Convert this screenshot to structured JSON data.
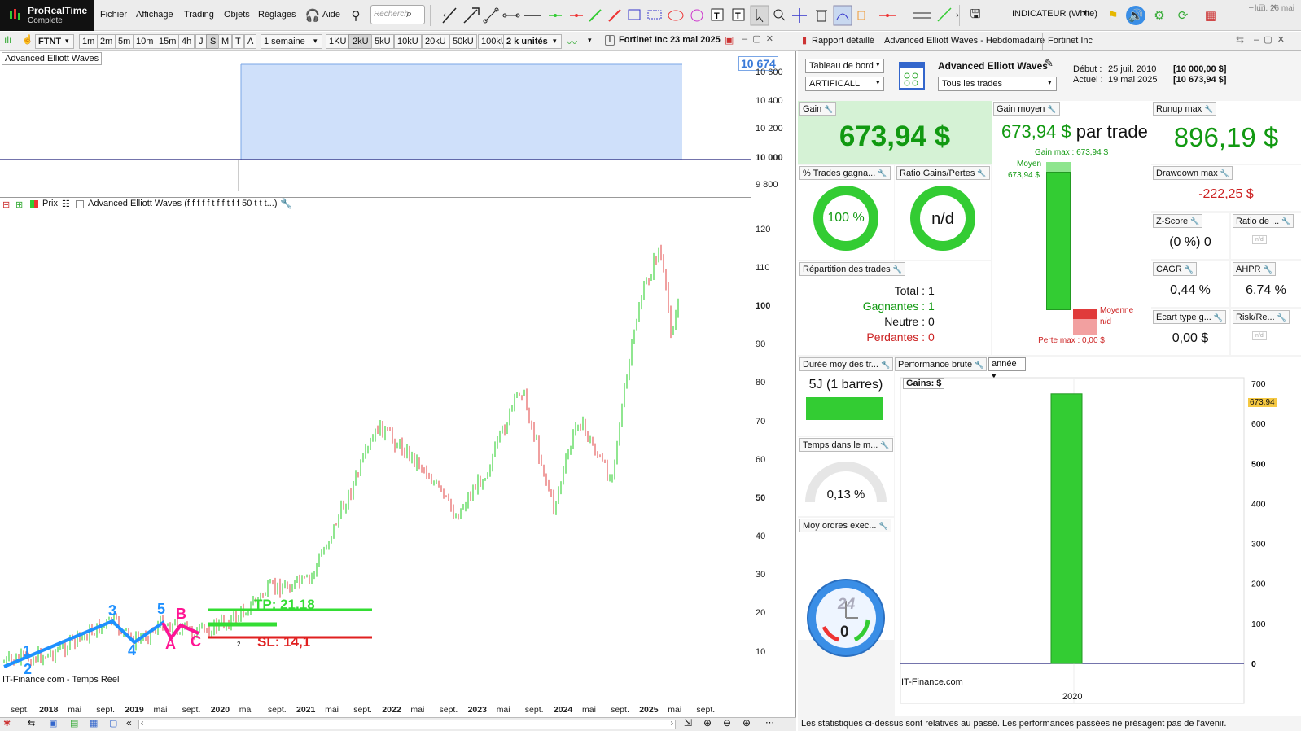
{
  "app": {
    "name": "ProRealTime",
    "edition": "Complete"
  },
  "menu": [
    "Fichier",
    "Affichage",
    "Trading",
    "Objets",
    "Réglages",
    "Aide"
  ],
  "search": {
    "placeholder": "Recherch"
  },
  "indicator_label": "INDICATEUR (White)",
  "clock": "lun. 26 mai",
  "chart_toolbar": {
    "symbol": "FTNT",
    "timeframes": [
      "1m",
      "2m",
      "5m",
      "10m",
      "15m",
      "4h",
      "J",
      "S",
      "M",
      "T",
      "A"
    ],
    "period": "1 semaine",
    "ticks": [
      "1KU",
      "2kU",
      "5kU",
      "10kU",
      "20kU",
      "50kU",
      "100kU"
    ],
    "units": "2 k unités",
    "title": "Fortinet Inc 23 mai 2025"
  },
  "upper_chart": {
    "legend": "Advanced Elliott Waves",
    "last_value": "10 674",
    "y_ticks": [
      "10 600",
      "10 400",
      "10 200",
      "10 000",
      "9 800"
    ]
  },
  "lower_chart": {
    "legend_price": "Prix",
    "legend_indicator": "Advanced Elliott Waves (f f f f f t f f t f f 50 t t t...)",
    "y_ticks": [
      "120",
      "110",
      "100",
      "90",
      "80",
      "70",
      "60",
      "50",
      "40",
      "30",
      "20",
      "10"
    ],
    "wave_labels": [
      "1",
      "2",
      "3",
      "4",
      "5",
      "A",
      "B",
      "C"
    ],
    "tp_label": "TP: 21,18",
    "sl_label": "SL: 14,1",
    "entry_mark": "2",
    "watermark": "IT-Finance.com - Temps Réel",
    "x_ticks": [
      {
        "t": "sept.",
        "b": false
      },
      {
        "t": "2018",
        "b": true
      },
      {
        "t": "mai",
        "b": false
      },
      {
        "t": "sept.",
        "b": false
      },
      {
        "t": "2019",
        "b": true
      },
      {
        "t": "mai",
        "b": false
      },
      {
        "t": "sept.",
        "b": false
      },
      {
        "t": "2020",
        "b": true
      },
      {
        "t": "mai",
        "b": false
      },
      {
        "t": "sept.",
        "b": false
      },
      {
        "t": "2021",
        "b": true
      },
      {
        "t": "mai",
        "b": false
      },
      {
        "t": "sept.",
        "b": false
      },
      {
        "t": "2022",
        "b": true
      },
      {
        "t": "mai",
        "b": false
      },
      {
        "t": "sept.",
        "b": false
      },
      {
        "t": "2023",
        "b": true
      },
      {
        "t": "mai",
        "b": false
      },
      {
        "t": "sept.",
        "b": false
      },
      {
        "t": "2024",
        "b": true
      },
      {
        "t": "mai",
        "b": false
      },
      {
        "t": "sept.",
        "b": false
      },
      {
        "t": "2025",
        "b": true
      },
      {
        "t": "mai",
        "b": false
      },
      {
        "t": "sept.",
        "b": false
      }
    ]
  },
  "report": {
    "tabs": [
      "Rapport détaillé",
      "Advanced Elliott Waves - Hebdomadaire",
      "Fortinet Inc"
    ],
    "dashboard": "Tableau de bord",
    "account": "ARTIFICALL",
    "strategy": "Advanced Elliott Waves",
    "filter": "Tous les trades",
    "start_label": "Début :",
    "start_date": "25 juil. 2010",
    "start_value": "[10 000,00 $]",
    "current_label": "Actuel :",
    "current_date": "19 mai 2025",
    "current_value": "[10 673,94 $]",
    "gain_label": "Gain",
    "gain": "673,94 $",
    "avg_gain_label": "Gain moyen",
    "avg_gain": "673,94 $",
    "avg_gain_suffix": "par trade",
    "gain_max": "Gain max : 673,94 $",
    "moyen_label": "Moyen",
    "moyen_value": "673,94 $",
    "moyenne_label": "Moyenne",
    "moyenne_value": "n/d",
    "perte_max": "Perte max : 0,00 $",
    "runup_label": "Runup max",
    "runup": "896,19 $",
    "drawdown_label": "Drawdown max",
    "drawdown": "-222,25 $",
    "pct_winners_label": "% Trades gagna...",
    "pct_winners": "100 %",
    "ratio_label": "Ratio Gains/Pertes",
    "ratio": "n/d",
    "zscore_label": "Z-Score",
    "zscore": "(0 %) 0",
    "ratio2_label": "Ratio de ...",
    "ratio2": "n/d",
    "cagr_label": "CAGR",
    "cagr": "0,44 %",
    "ahpr_label": "AHPR",
    "ahpr": "6,74 %",
    "std_label": "Ecart type g...",
    "std": "0,00 $",
    "risk_label": "Risk/Re...",
    "risk": "n/d",
    "repartition_label": "Répartition des trades",
    "total_label": "Total :",
    "total": "1",
    "winners_label": "Gagnantes :",
    "winners": "1",
    "neutral_label": "Neutre :",
    "neutral": "0",
    "losers_label": "Perdantes :",
    "losers": "0",
    "duration_label": "Durée moy des tr...",
    "duration": "5J (1 barres)",
    "time_label": "Temps dans le m...",
    "time": "0,13 %",
    "orders_label": "Moy ordres exec...",
    "orders": "0",
    "orders_clock": "24",
    "perf_label": "Performance brute",
    "perf_period": "année",
    "perf_series": "Gains: $",
    "perf_value_tag": "673,94",
    "perf_y_ticks": [
      "700",
      "600",
      "500",
      "400",
      "300",
      "200",
      "100",
      "0"
    ],
    "perf_watermark": "IT-Finance.com",
    "footer": "Les statistiques ci-dessus sont relatives au passé. Les performances passées ne présagent pas de l'avenir."
  },
  "chart_data": {
    "type": "bar",
    "categories": [
      "2020"
    ],
    "series": [
      {
        "name": "Gains: $",
        "values": [
          673.94
        ]
      }
    ],
    "ylim": [
      0,
      700
    ]
  },
  "colors": {
    "green": "#33cc33",
    "red": "#dd2222",
    "blue": "#1e90ff",
    "pink": "#ff1493",
    "gain_bg": "#d5f2d5"
  }
}
